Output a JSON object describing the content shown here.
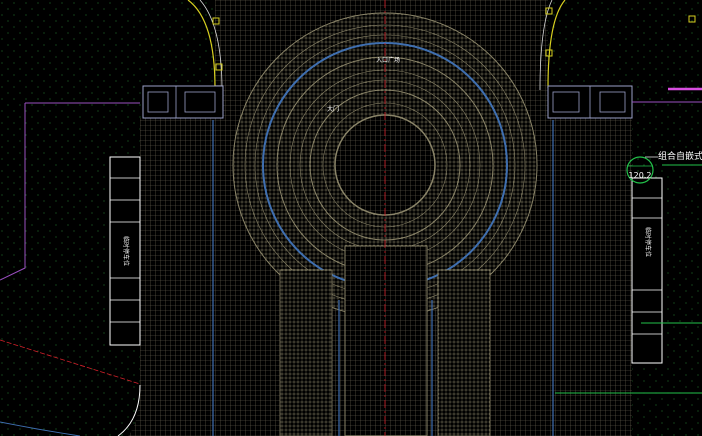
{
  "drawing": {
    "background": "#000000",
    "grid_color": "#6f6a55",
    "ring_color": "#8a8468",
    "accent_blue": "#3f6fb0",
    "accent_green": "#22c24a",
    "accent_magenta": "#c43ad0",
    "accent_red": "#d4202a",
    "accent_yellow": "#d8d020"
  },
  "labels": {
    "plaza_name": "入口广场",
    "gate_label": "大门",
    "left_parking": "临时停车位",
    "right_parking": "临时停车位",
    "annotation_text": "组合自嵌式挡",
    "elevation_tag": "120.2"
  }
}
